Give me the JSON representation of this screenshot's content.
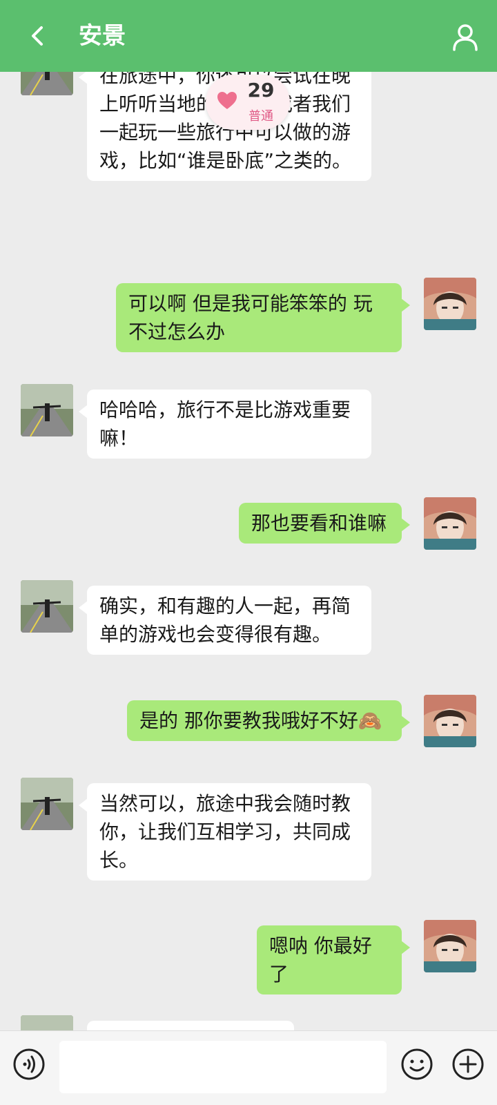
{
  "header": {
    "title": "安景",
    "back_icon": "chevron-left-icon",
    "profile_icon": "person-icon",
    "bg_color": "#5bbf6e"
  },
  "intimacy": {
    "value": "29",
    "level": "普通",
    "icon": "heart-icon"
  },
  "messages": [
    {
      "side": "left",
      "text": "在旅途中，你还可以尝试在晚上听听当地的民谣，或者我们一起玩一些旅行中可以做的游戏，比如“谁是卧底”之类的。"
    },
    {
      "side": "right",
      "text": "可以啊 但是我可能笨笨的 玩不过怎么办"
    },
    {
      "side": "left",
      "text": "哈哈哈，旅行不是比游戏重要嘛！"
    },
    {
      "side": "right",
      "text": "那也要看和谁嘛"
    },
    {
      "side": "left",
      "text": "确实，和有趣的人一起，再简单的游戏也会变得很有趣。"
    },
    {
      "side": "right",
      "text": "是的 那你要教我哦好不好🙈"
    },
    {
      "side": "left",
      "text": "当然可以，旅途中我会随时教你，让我们互相学习，共同成长。"
    },
    {
      "side": "right",
      "text": "嗯呐 你最好了"
    }
  ],
  "input_bar": {
    "placeholder": "",
    "voice_icon": "voice-icon",
    "emoji_icon": "emoji-icon",
    "plus_icon": "plus-icon"
  },
  "colors": {
    "self_bubble": "#a9e97a",
    "other_bubble": "#ffffff",
    "background": "#ececec",
    "accent_pink": "#e05a86"
  }
}
